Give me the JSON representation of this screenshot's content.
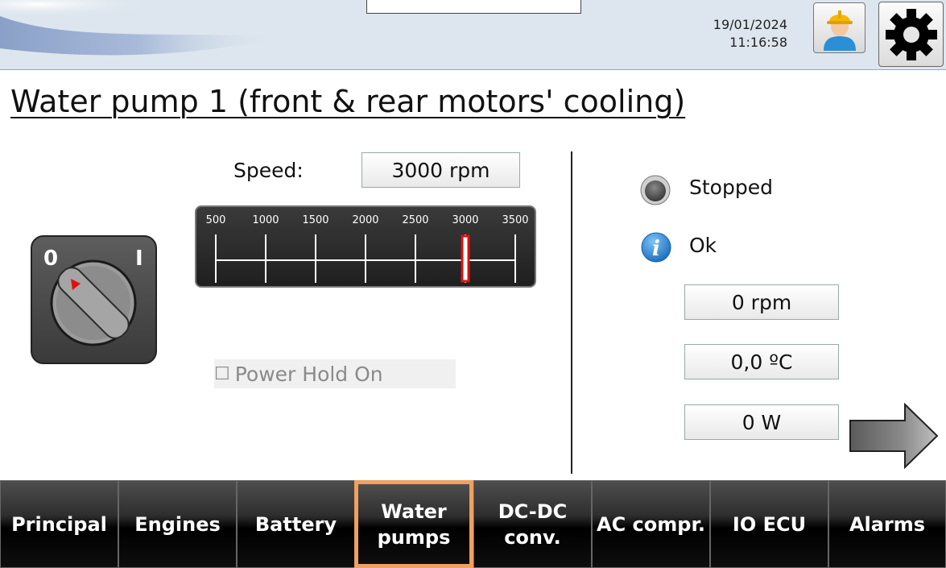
{
  "header": {
    "date": "19/01/2024",
    "time": "11:16:58",
    "user_icon": "user-worker-icon",
    "settings_icon": "gear-icon"
  },
  "page": {
    "title": "Water pump 1 (front & rear motors' cooling)"
  },
  "switch": {
    "label_off": "0",
    "label_on": "I",
    "position": "0"
  },
  "speed": {
    "label": "Speed:",
    "value": "3000 rpm",
    "gauge_ticks": [
      "500",
      "1000",
      "1500",
      "2000",
      "2500",
      "3000",
      "3500"
    ],
    "gauge_min": 500,
    "gauge_max": 3500,
    "gauge_value": 3000
  },
  "power_hold": {
    "checkbox": "☐",
    "label": "Power Hold On"
  },
  "status": {
    "state": "Stopped",
    "info": "Ok",
    "info_icon": "info-icon",
    "rpm": "0 rpm",
    "temperature": "0,0 ºC",
    "power": "0 W"
  },
  "nav": {
    "items": [
      {
        "label": "Principal",
        "active": false
      },
      {
        "label": "Engines",
        "active": false
      },
      {
        "label": "Battery",
        "active": false
      },
      {
        "label": "Water\npumps",
        "active": true
      },
      {
        "label": "DC-DC\nconv.",
        "active": false
      },
      {
        "label": "AC compr.",
        "active": false
      },
      {
        "label": "IO ECU",
        "active": false
      },
      {
        "label": "Alarms",
        "active": false
      }
    ]
  },
  "colors": {
    "accent": "#f0a060",
    "header_bg": "#dde6ee",
    "info_blue": "#1e88d8",
    "gauge_marker": "#e01010"
  }
}
